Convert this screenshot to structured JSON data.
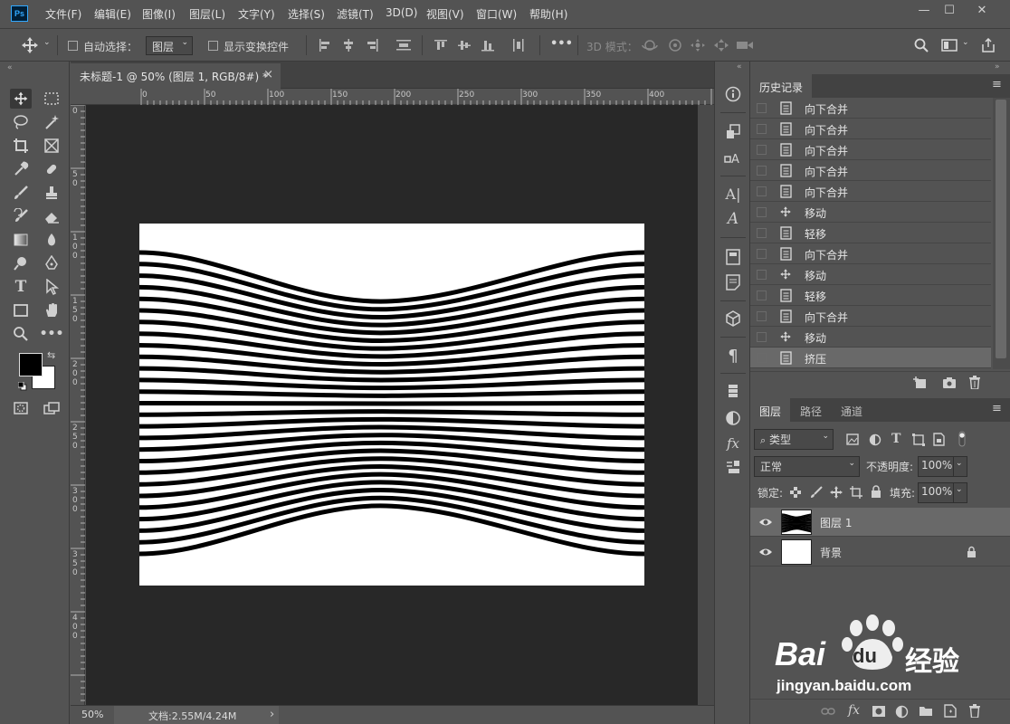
{
  "app": {
    "logo": "Ps"
  },
  "menu": [
    {
      "label": "文件(F)"
    },
    {
      "label": "编辑(E)"
    },
    {
      "label": "图像(I)"
    },
    {
      "label": "图层(L)"
    },
    {
      "label": "文字(Y)"
    },
    {
      "label": "选择(S)"
    },
    {
      "label": "滤镜(T)"
    },
    {
      "label": "3D(D)"
    },
    {
      "label": "视图(V)"
    },
    {
      "label": "窗口(W)"
    },
    {
      "label": "帮助(H)"
    }
  ],
  "window": {
    "minimize": "—",
    "maximize": "☐",
    "close": "✕"
  },
  "options": {
    "auto_select_label": "自动选择：",
    "auto_select_target": "图层",
    "show_transform_label": "显示变换控件",
    "three_d_mode_label": "3D 模式：",
    "more": "•••"
  },
  "document": {
    "tab_title": "未标题-1 @ 50% (图层 1, RGB/8#) *",
    "close": "×"
  },
  "rulers": {
    "horizontal": [
      "0",
      "50",
      "100",
      "150",
      "200",
      "250",
      "300",
      "350",
      "400"
    ],
    "vertical": [
      "0",
      "5 0",
      "1 0 0",
      "1 5 0",
      "2 0 0",
      "2 5 0",
      "3 0 0",
      "3 5 0",
      "4 0 0"
    ]
  },
  "status": {
    "zoom": "50%",
    "doc_info": "文档:2.55M/4.24M",
    "arrow": "›"
  },
  "history": {
    "tab": "历史记录",
    "items": [
      {
        "icon": "document-icon",
        "label": "向下合并"
      },
      {
        "icon": "document-icon",
        "label": "向下合并"
      },
      {
        "icon": "document-icon",
        "label": "向下合并"
      },
      {
        "icon": "document-icon",
        "label": "向下合并"
      },
      {
        "icon": "document-icon",
        "label": "向下合并"
      },
      {
        "icon": "move-icon",
        "label": "移动"
      },
      {
        "icon": "document-icon",
        "label": "轻移"
      },
      {
        "icon": "document-icon",
        "label": "向下合并"
      },
      {
        "icon": "move-icon",
        "label": "移动"
      },
      {
        "icon": "document-icon",
        "label": "轻移"
      },
      {
        "icon": "document-icon",
        "label": "向下合并"
      },
      {
        "icon": "move-icon",
        "label": "移动"
      },
      {
        "icon": "document-icon",
        "label": "挤压"
      }
    ],
    "selected_index": 12
  },
  "layers_panel": {
    "tabs": [
      "图层",
      "路径",
      "通道"
    ],
    "filter_label": "类型",
    "blend_mode": "正常",
    "opacity_label": "不透明度:",
    "opacity_value": "100%",
    "lock_label": "锁定:",
    "fill_label": "填充:",
    "fill_value": "100%",
    "layers": [
      {
        "name": "图层 1",
        "selected": true
      },
      {
        "name": "背景",
        "selected": false,
        "locked": true
      }
    ]
  },
  "watermark": {
    "brand": "Bai",
    "brand2": "du",
    "product": "经验",
    "url": "jingyan.baidu.com"
  },
  "colors": {
    "panel": "#535353",
    "workspace": "#282828",
    "accent": "#31a8ff"
  }
}
